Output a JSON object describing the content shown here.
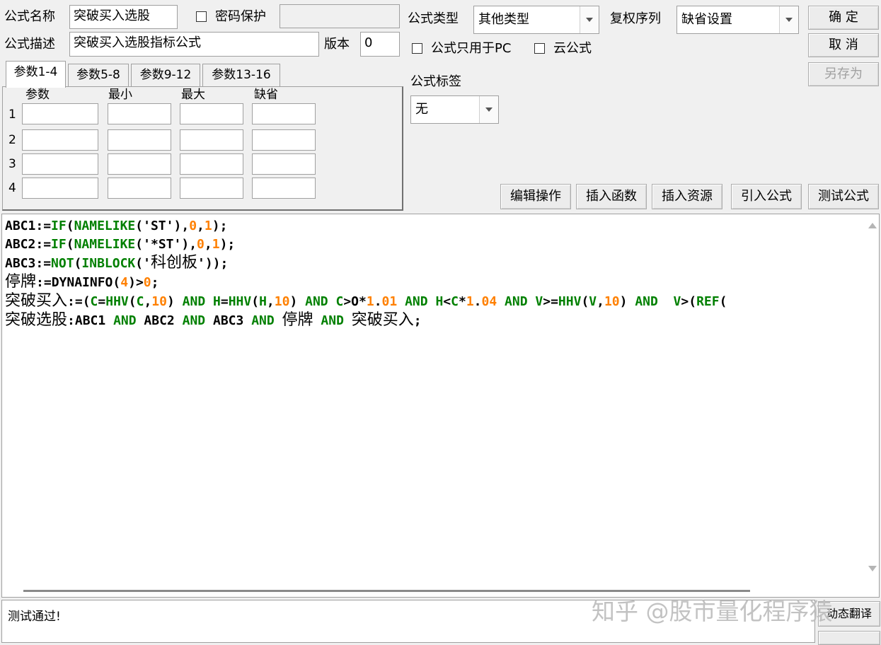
{
  "form": {
    "name_label": "公式名称",
    "name_value": "突破买入选股",
    "password_label": "密码保护",
    "desc_label": "公式描述",
    "desc_value": "突破买入选股指标公式",
    "version_label": "版本",
    "version_value": "0",
    "type_label": "公式类型",
    "type_value": "其他类型",
    "rights_label": "复权序列",
    "rights_value": "缺省设置",
    "pc_only_label": "公式只用于PC",
    "cloud_label": "云公式",
    "tag_label": "公式标签",
    "tag_value": "无"
  },
  "buttons": {
    "ok": "确 定",
    "cancel": "取 消",
    "save_as": "另存为",
    "edit_ops": "编辑操作",
    "insert_func": "插入函数",
    "insert_res": "插入资源",
    "import_formula": "引入公式",
    "test_formula": "测试公式",
    "dynamic_translate": "动态翻译"
  },
  "tabs": [
    {
      "label": "参数1-4",
      "active": true
    },
    {
      "label": "参数5-8",
      "active": false
    },
    {
      "label": "参数9-12",
      "active": false
    },
    {
      "label": "参数13-16",
      "active": false
    }
  ],
  "params": {
    "headers": [
      "参数",
      "最小",
      "最大",
      "缺省"
    ],
    "rows": [
      "1",
      "2",
      "3",
      "4"
    ]
  },
  "code_lines": [
    "ABC1:=IF(NAMELIKE('ST'),0,1);",
    "ABC2:=IF(NAMELIKE('*ST'),0,1);",
    "ABC3:=NOT(INBLOCK('科创板'));",
    "停牌:=DYNAINFO(4)>0;",
    "突破买入:=(C=HHV(C,10) AND H=HHV(H,10) AND C>O*1.01 AND H<C*1.04 AND V>=HHV(V,10) AND  V>(REF(",
    "突破选股:ABC1 AND ABC2 AND ABC3 AND 停牌 AND 突破买入;"
  ],
  "status_text": "测试通过!",
  "watermark": "知乎 @股市量化程序猿",
  "colors": {
    "function": "#008000",
    "number": "#ff8000",
    "text": "#000000"
  }
}
